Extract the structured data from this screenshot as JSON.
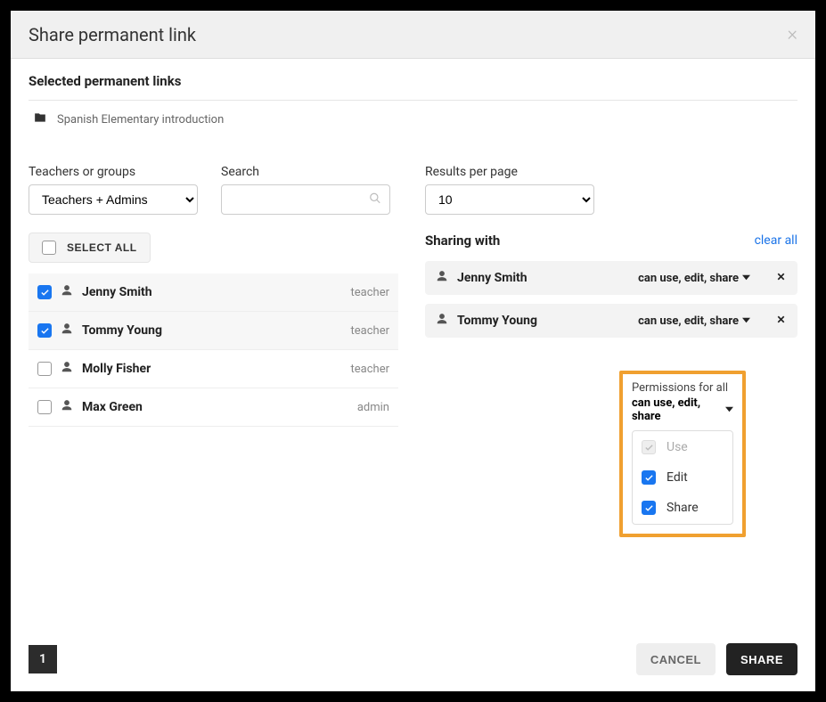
{
  "modal": {
    "title": "Share permanent link"
  },
  "selected_links": {
    "heading": "Selected permanent links",
    "items": [
      {
        "name": "Spanish Elementary introduction"
      }
    ]
  },
  "filters": {
    "teachers_label": "Teachers or groups",
    "teachers_value": "Teachers + Admins",
    "search_label": "Search",
    "search_value": "",
    "results_label": "Results per page",
    "results_value": "10"
  },
  "select_all_label": "SELECT ALL",
  "people": [
    {
      "name": "Jenny Smith",
      "role": "teacher",
      "checked": true
    },
    {
      "name": "Tommy Young",
      "role": "teacher",
      "checked": true
    },
    {
      "name": "Molly Fisher",
      "role": "teacher",
      "checked": false
    },
    {
      "name": "Max Green",
      "role": "admin",
      "checked": false
    }
  ],
  "sharing": {
    "heading": "Sharing with",
    "clear_all": "clear all",
    "rows": [
      {
        "name": "Jenny Smith",
        "perm": "can use, edit, share"
      },
      {
        "name": "Tommy Young",
        "perm": "can use, edit, share"
      }
    ]
  },
  "perm_panel": {
    "caption": "Permissions for all",
    "summary": "can use, edit, share",
    "options": [
      {
        "label": "Use",
        "checked": true,
        "disabled": true
      },
      {
        "label": "Edit",
        "checked": true,
        "disabled": false
      },
      {
        "label": "Share",
        "checked": true,
        "disabled": false
      }
    ]
  },
  "pagination": {
    "current": "1"
  },
  "buttons": {
    "cancel": "CANCEL",
    "share": "SHARE"
  }
}
